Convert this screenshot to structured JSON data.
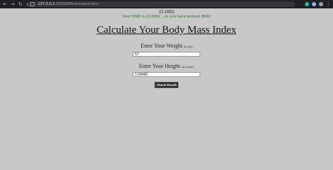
{
  "browser": {
    "url_host": "127.0.0.1",
    "url_path": ":5500/BMIcalculator.html"
  },
  "result": {
    "bmi_value": "22.6902",
    "message": "Your BMI is 22.6902 , so you have normal BMI!"
  },
  "page": {
    "title": "Calculate Your Body Mass Index"
  },
  "weight": {
    "label": "Enter Your Weight",
    "unit": "(in kg)",
    "value": "57"
  },
  "height": {
    "label": "Enter Your Height",
    "unit": "(in meter)",
    "value": "1.58496"
  },
  "actions": {
    "check_label": "Check Result"
  }
}
